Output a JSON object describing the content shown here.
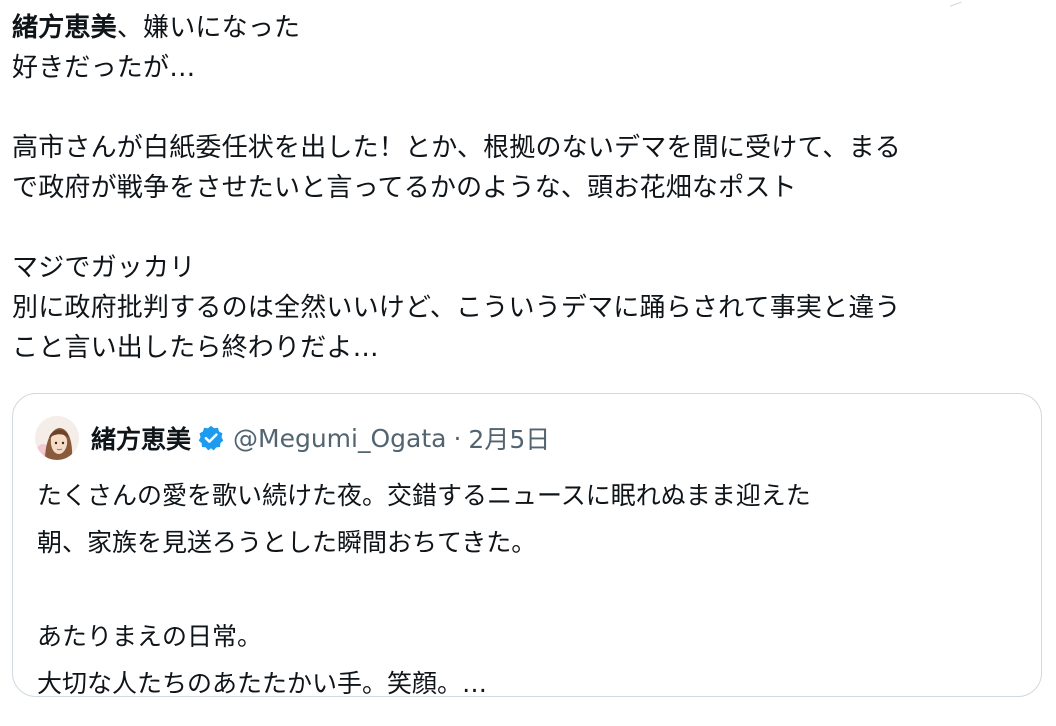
{
  "post": {
    "title_bold": "緒方恵美",
    "title_rest": "、嫌いになった",
    "lines": [
      "好きだったが…",
      "",
      "高市さんが白紙委任状を出した！とか、根拠のないデマを間に受けて、まる",
      "で政府が戦争をさせたいと言ってるかのような、頭お花畑なポスト",
      "",
      "マジでガッカリ",
      "別に政府批判するのは全然いいけど、こういうデマに踊らされて事実と違う",
      "こと言い出したら終わりだよ…"
    ]
  },
  "quote": {
    "name": "緒方恵美",
    "handle": "@Megumi_Ogata",
    "separator": "·",
    "date": "2月5日",
    "verified_icon": "verified-badge-icon",
    "accent_color": "#1d9bf0",
    "lines": [
      "たくさんの愛を歌い続けた夜。交錯するニュースに眠れぬまま迎えた",
      "朝、家族を見送ろうとした瞬間おちてきた。",
      "",
      "あたりまえの日常。",
      "大切な人たちのあたたかい手。笑顔。…"
    ]
  },
  "colors": {
    "text": "#0f1419",
    "secondary": "#536471",
    "border": "#cfd9de"
  }
}
